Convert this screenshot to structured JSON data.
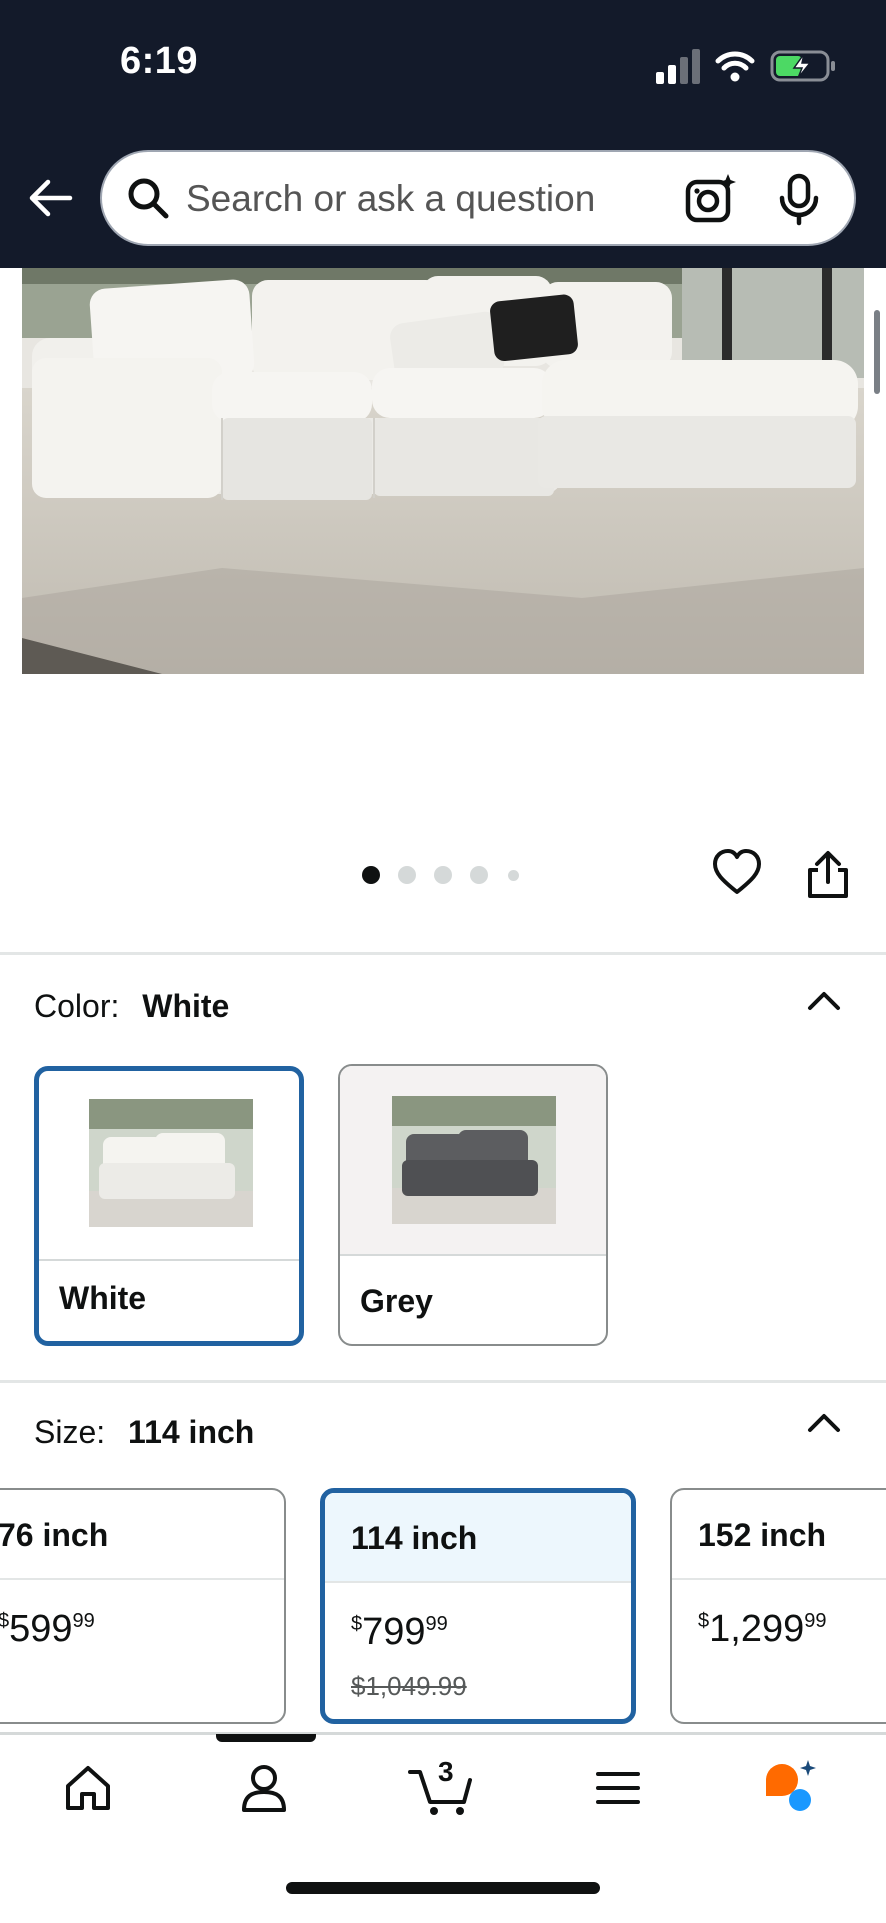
{
  "status_bar": {
    "time": "6:19"
  },
  "search": {
    "placeholder": "Search or ask a question"
  },
  "carousel": {
    "total": 5,
    "active_index": 0
  },
  "color_section": {
    "label": "Color:",
    "selected": "White",
    "options": [
      {
        "label": "White",
        "selected": true
      },
      {
        "label": "Grey",
        "selected": false
      }
    ]
  },
  "size_section": {
    "label": "Size:",
    "selected": "114 inch",
    "options": [
      {
        "label": "76 inch",
        "price_symbol": "$",
        "price_whole": "599",
        "price_fraction": "99",
        "old_price": ""
      },
      {
        "label": "114 inch",
        "price_symbol": "$",
        "price_whole": "799",
        "price_fraction": "99",
        "old_price": "$1,049.99",
        "selected": true
      },
      {
        "label": "152 inch",
        "price_symbol": "$",
        "price_whole": "1,299",
        "price_fraction": "99",
        "old_price": ""
      }
    ]
  },
  "bottom_nav": {
    "cart_count": "3"
  },
  "colors": {
    "header_bg": "#131a2a",
    "selected_border": "#2162a1",
    "selected_fill": "#edf7fd"
  }
}
